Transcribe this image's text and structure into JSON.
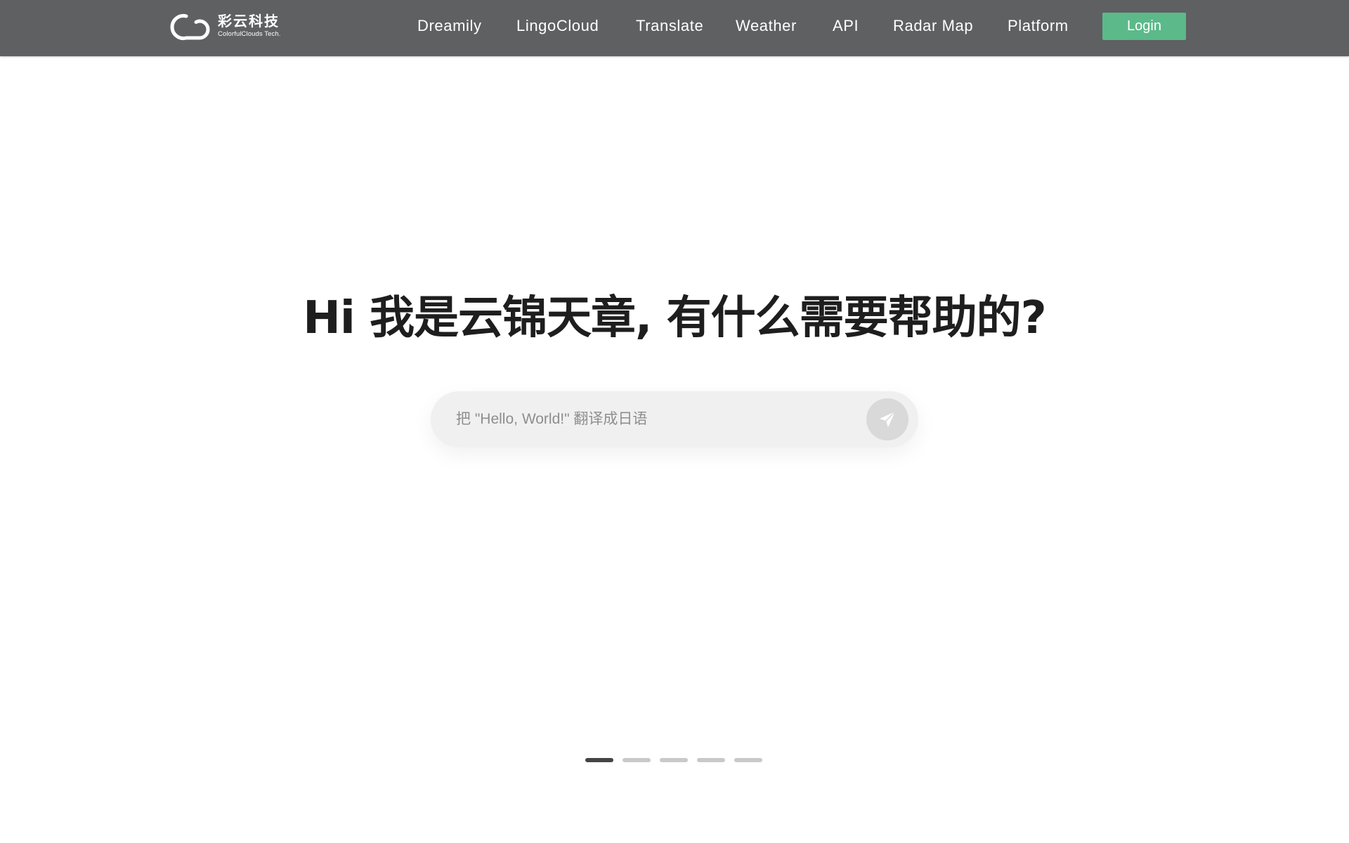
{
  "brand": {
    "name_cn": "彩云科技",
    "name_en": "ColorfulClouds Tech.",
    "icon": "cloud-logo-icon"
  },
  "nav": {
    "items": [
      {
        "label": "Dreamily"
      },
      {
        "label": "LingoCloud"
      },
      {
        "label": "Translate"
      },
      {
        "label": "Weather"
      },
      {
        "label": "API"
      },
      {
        "label": "Radar Map"
      },
      {
        "label": "Platform"
      }
    ],
    "login_label": "Login"
  },
  "hero": {
    "title": "Hi 我是云锦天章, 有什么需要帮助的?"
  },
  "search": {
    "placeholder": "把 \"Hello, World!\" 翻译成日语",
    "value": "",
    "send_icon": "send-icon"
  },
  "carousel": {
    "slide_count": 5,
    "active_index": 0
  },
  "colors": {
    "navbar_bg": "#5f6062",
    "login_bg": "#5cb98a",
    "title_color": "#1e1e1e",
    "search_bg": "#f0f0f0",
    "dot_active": "#444444",
    "dot_inactive": "#c9c9c9"
  }
}
